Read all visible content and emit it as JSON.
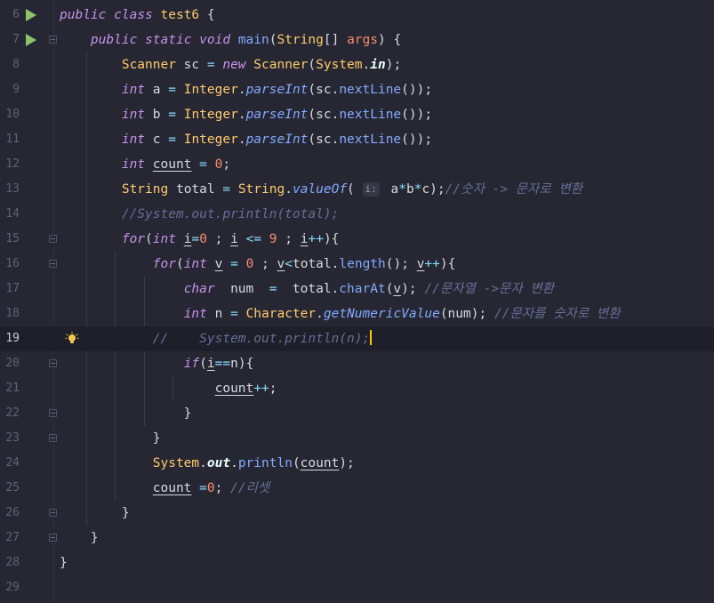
{
  "editor": {
    "language": "Java",
    "current_line": 19,
    "colors": {
      "background": "#262733",
      "current_line": "#1e1f28",
      "keyword": "#c792ea",
      "type": "#ffcb6b",
      "function": "#82aaff",
      "number": "#f78c6c",
      "comment": "#676e95",
      "run_icon": "#8ac46b",
      "caret": "#ffcc00"
    },
    "lines": [
      {
        "n": "6",
        "t": "public class test6 {"
      },
      {
        "n": "7",
        "t": "    public static void main(String[] args) {"
      },
      {
        "n": "8",
        "t": "        Scanner sc = new Scanner(System.in);"
      },
      {
        "n": "9",
        "t": "        int a = Integer.parseInt(sc.nextLine());"
      },
      {
        "n": "10",
        "t": "        int b = Integer.parseInt(sc.nextLine());"
      },
      {
        "n": "11",
        "t": "        int c = Integer.parseInt(sc.nextLine());"
      },
      {
        "n": "12",
        "t": "        int count = 0;"
      },
      {
        "n": "13",
        "t": "        String total = String.valueOf( i: a*b*c);//숫자 -> 문자로 변환"
      },
      {
        "n": "14",
        "t": "        //System.out.println(total);"
      },
      {
        "n": "15",
        "t": "        for(int i=0 ; i <= 9 ; i++){"
      },
      {
        "n": "16",
        "t": "            for(int v = 0 ; v<total.length(); v++){"
      },
      {
        "n": "17",
        "t": "                char  num  =  total.charAt(v); //문자열 ->문자 변환"
      },
      {
        "n": "18",
        "t": "                int n = Character.getNumericValue(num); //문자를 숫자로 변환"
      },
      {
        "n": "19",
        "t": "            //    System.out.println(n);"
      },
      {
        "n": "20",
        "t": "                if(i==n){"
      },
      {
        "n": "21",
        "t": "                    count++;"
      },
      {
        "n": "22",
        "t": "                }"
      },
      {
        "n": "23",
        "t": "            }"
      },
      {
        "n": "24",
        "t": "            System.out.println(count);"
      },
      {
        "n": "25",
        "t": "            count =0; //리셋"
      },
      {
        "n": "26",
        "t": "        }"
      },
      {
        "n": "27",
        "t": "    }"
      },
      {
        "n": "28",
        "t": "}"
      },
      {
        "n": "29",
        "t": ""
      }
    ],
    "gutter_icons": {
      "run_lines": [
        "6",
        "7"
      ],
      "intention_bulb_line": "19",
      "fold_lines": [
        "7",
        "15",
        "16",
        "20",
        "22",
        "23",
        "26",
        "27"
      ]
    }
  }
}
